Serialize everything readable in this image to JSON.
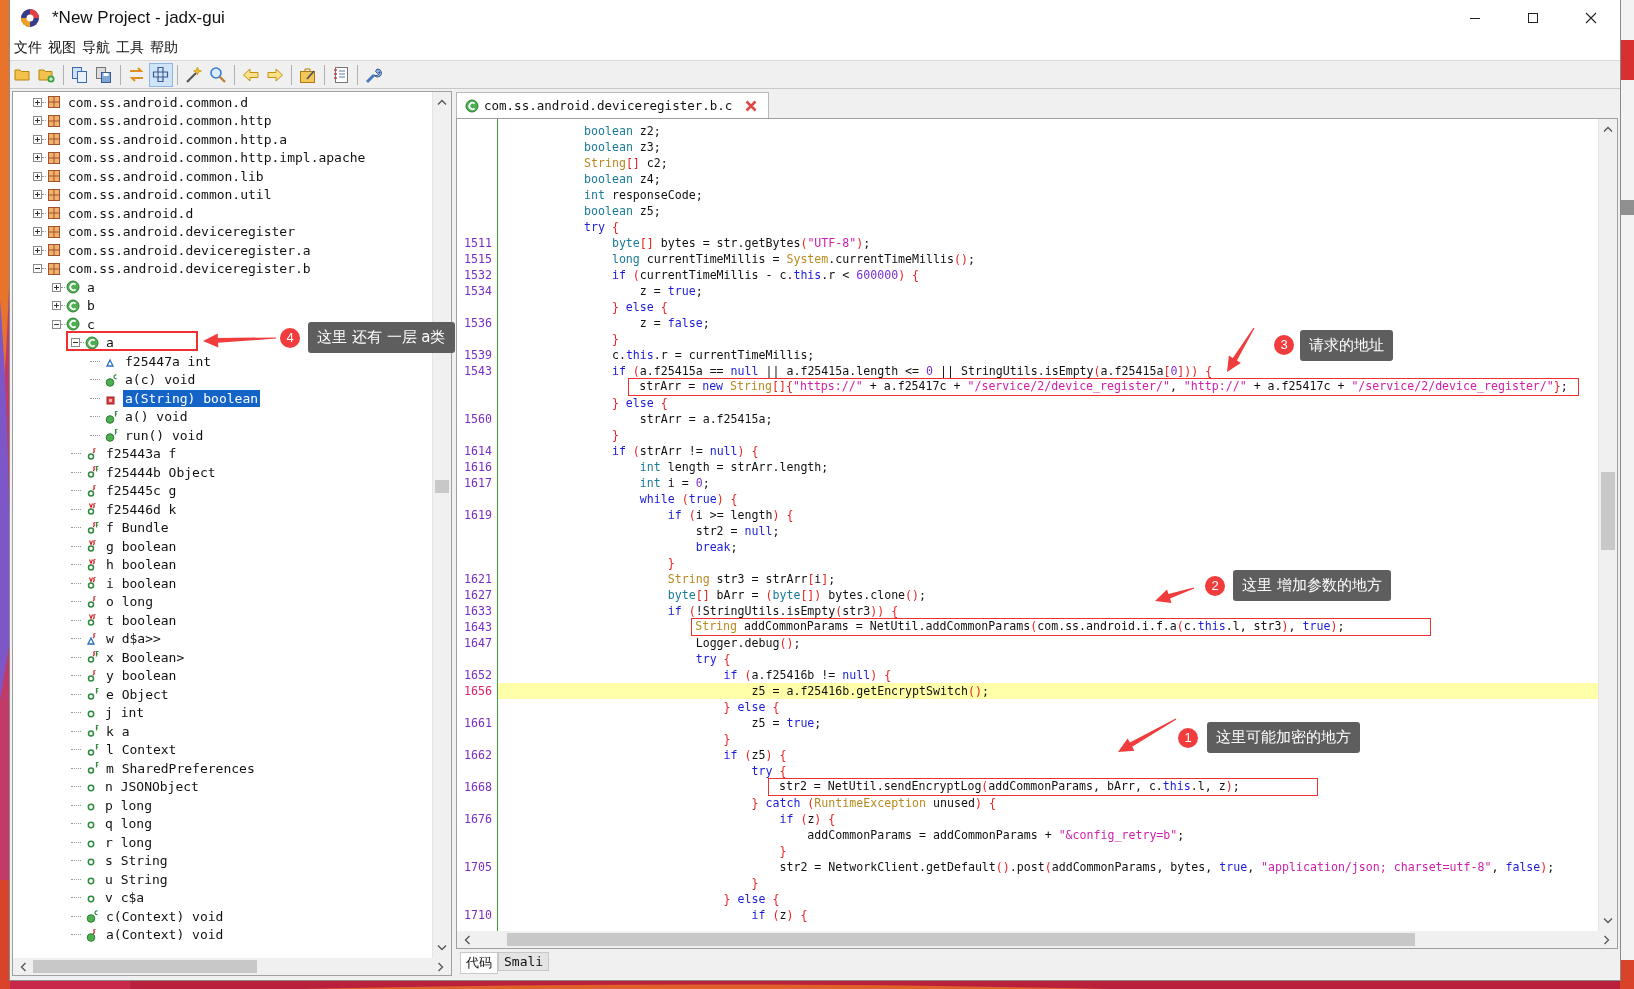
{
  "window": {
    "title": "*New Project - jadx-gui"
  },
  "menu": [
    "文件",
    "视图",
    "导航",
    "工具",
    "帮助"
  ],
  "toolbar": {
    "buttons": [
      {
        "pressed": false
      },
      {
        "pressed": false
      },
      {
        "pressed": false
      },
      {
        "pressed": false
      },
      {
        "pressed": false
      },
      {
        "pressed": true
      },
      {
        "pressed": false
      },
      {
        "pressed": false
      },
      {
        "pressed": false
      },
      {
        "pressed": false
      },
      {
        "pressed": false
      },
      {
        "pressed": false
      },
      {
        "pressed": false
      }
    ]
  },
  "tree": [
    {
      "label": "com.ss.android.common.d",
      "kind": "package",
      "expanded": false,
      "selected": false
    },
    {
      "label": "com.ss.android.common.http",
      "kind": "package",
      "expanded": false,
      "selected": false
    },
    {
      "label": "com.ss.android.common.http.a",
      "kind": "package",
      "expanded": false,
      "selected": false
    },
    {
      "label": "com.ss.android.common.http.impl.apache",
      "kind": "package",
      "expanded": false,
      "selected": false
    },
    {
      "label": "com.ss.android.common.lib",
      "kind": "package",
      "expanded": false,
      "selected": false
    },
    {
      "label": "com.ss.android.common.util",
      "kind": "package",
      "expanded": false,
      "selected": false
    },
    {
      "label": "com.ss.android.d",
      "kind": "package",
      "expanded": false,
      "selected": false
    },
    {
      "label": "com.ss.android.deviceregister",
      "kind": "package",
      "expanded": false,
      "selected": false
    },
    {
      "label": "com.ss.android.deviceregister.a",
      "kind": "package",
      "expanded": false,
      "selected": false
    },
    {
      "label": "com.ss.android.deviceregister.b",
      "kind": "package",
      "expanded": true,
      "selected": false,
      "children": [
        {
          "label": "a",
          "kind": "class",
          "expanded": false,
          "selected": false
        },
        {
          "label": "b",
          "kind": "class",
          "expanded": false,
          "selected": false
        },
        {
          "label": "c",
          "kind": "class",
          "expanded": true,
          "selected": false,
          "children": [
            {
              "label": "a",
              "kind": "class",
              "expanded": true,
              "selected": false,
              "children": [
                {
                  "label": "f25447a int",
                  "kind": "triangle",
                  "selected": false
                },
                {
                  "label": "a(c) void",
                  "kind": "method-c",
                  "selected": false
                },
                {
                  "label": "a(String) boolean",
                  "kind": "private",
                  "selected": true
                },
                {
                  "label": "a() void",
                  "kind": "method-f",
                  "selected": false
                },
                {
                  "label": "run() void",
                  "kind": "method-f",
                  "selected": false
                }
              ]
            },
            {
              "label": "f25443a f",
              "kind": "field-s",
              "selected": false
            },
            {
              "label": "f25444b Object",
              "kind": "field-sf",
              "selected": false
            },
            {
              "label": "f25445c g",
              "kind": "field-s",
              "selected": false
            },
            {
              "label": "f25446d k",
              "kind": "field-vs",
              "selected": false
            },
            {
              "label": "f Bundle",
              "kind": "field-sf",
              "selected": false
            },
            {
              "label": "g boolean",
              "kind": "field-vs",
              "selected": false
            },
            {
              "label": "h boolean",
              "kind": "field-vs",
              "selected": false
            },
            {
              "label": "i boolean",
              "kind": "field-vs",
              "selected": false
            },
            {
              "label": "o long",
              "kind": "field-s",
              "selected": false
            },
            {
              "label": "t boolean",
              "kind": "field-vs",
              "selected": false
            },
            {
              "label": "w d$a>>",
              "kind": "triangle-s",
              "selected": false
            },
            {
              "label": "x Boolean>",
              "kind": "field-sf",
              "selected": false
            },
            {
              "label": "y boolean",
              "kind": "field-s",
              "selected": false
            },
            {
              "label": "e Object",
              "kind": "field-f",
              "selected": false
            },
            {
              "label": "j int",
              "kind": "field",
              "selected": false
            },
            {
              "label": "k a",
              "kind": "field-f",
              "selected": false
            },
            {
              "label": "l Context",
              "kind": "field-f",
              "selected": false
            },
            {
              "label": "m SharedPreferences",
              "kind": "field-f",
              "selected": false
            },
            {
              "label": "n JSONObject",
              "kind": "field",
              "selected": false
            },
            {
              "label": "p long",
              "kind": "field",
              "selected": false
            },
            {
              "label": "q long",
              "kind": "field",
              "selected": false
            },
            {
              "label": "r long",
              "kind": "field",
              "selected": false
            },
            {
              "label": "s String",
              "kind": "field",
              "selected": false
            },
            {
              "label": "u String",
              "kind": "field",
              "selected": false
            },
            {
              "label": "v c$a",
              "kind": "field",
              "selected": false
            },
            {
              "label": "c(Context) void",
              "kind": "method-c",
              "selected": false
            },
            {
              "label": "a(Context) void",
              "kind": "method-s",
              "selected": false
            }
          ]
        }
      ]
    }
  ],
  "editor": {
    "tabs": [
      {
        "label": "com.ss.android.deviceregister.b.c",
        "selected": true
      }
    ],
    "lines": [
      {
        "highlighted": false,
        "tokens": [
          {
            "kind": "type",
            "text": "boolean"
          },
          {
            "kind": "plain",
            "text": " z2;"
          }
        ]
      },
      {
        "highlighted": false,
        "tokens": [
          {
            "kind": "type",
            "text": "boolean"
          },
          {
            "kind": "plain",
            "text": " z3;"
          }
        ]
      },
      {
        "highlighted": false,
        "tokens": [
          {
            "kind": "class",
            "text": "String"
          },
          {
            "kind": "bracket",
            "text": "[]"
          },
          {
            "kind": "plain",
            "text": " c2;"
          }
        ]
      },
      {
        "highlighted": false,
        "tokens": [
          {
            "kind": "type",
            "text": "boolean"
          },
          {
            "kind": "plain",
            "text": " z4;"
          }
        ]
      },
      {
        "highlighted": false,
        "tokens": [
          {
            "kind": "type",
            "text": "int"
          },
          {
            "kind": "plain",
            "text": " responseCode;"
          }
        ]
      },
      {
        "highlighted": false,
        "tokens": [
          {
            "kind": "type",
            "text": "boolean"
          },
          {
            "kind": "plain",
            "text": " z5;"
          }
        ]
      },
      {
        "highlighted": false,
        "tokens": [
          {
            "kind": "keyword",
            "text": "try"
          },
          {
            "kind": "bracket",
            "text": " {"
          }
        ]
      },
      {
        "number": "1511",
        "highlighted": false,
        "tokens": [
          {
            "kind": "type",
            "text": "    byte"
          },
          {
            "kind": "bracket",
            "text": "[]"
          },
          {
            "kind": "plain",
            "text": " bytes = str.getBytes"
          },
          {
            "kind": "bracket",
            "text": "("
          },
          {
            "kind": "string",
            "text": "\"UTF-8\""
          },
          {
            "kind": "bracket",
            "text": ")"
          },
          {
            "kind": "plain",
            "text": ";"
          }
        ]
      },
      {
        "number": "1515",
        "highlighted": false,
        "tokens": [
          {
            "kind": "type",
            "text": "    long"
          },
          {
            "kind": "plain",
            "text": " currentTimeMillis = "
          },
          {
            "kind": "class",
            "text": "System"
          },
          {
            "kind": "plain",
            "text": ".currentTimeMillis"
          },
          {
            "kind": "bracket",
            "text": "()"
          },
          {
            "kind": "plain",
            "text": ";"
          }
        ]
      },
      {
        "number": "1532",
        "highlighted": false,
        "tokens": [
          {
            "kind": "keyword",
            "text": "    if"
          },
          {
            "kind": "bracket",
            "text": " ("
          },
          {
            "kind": "plain",
            "text": "currentTimeMillis - c."
          },
          {
            "kind": "keyword",
            "text": "this"
          },
          {
            "kind": "plain",
            "text": ".r < "
          },
          {
            "kind": "number",
            "text": "600000"
          },
          {
            "kind": "bracket",
            "text": ")"
          },
          {
            "kind": "bracket",
            "text": " {"
          }
        ]
      },
      {
        "number": "1534",
        "highlighted": false,
        "tokens": [
          {
            "kind": "plain",
            "text": "        z = "
          },
          {
            "kind": "keyword",
            "text": "true"
          },
          {
            "kind": "plain",
            "text": ";"
          }
        ]
      },
      {
        "highlighted": false,
        "tokens": [
          {
            "kind": "bracket",
            "text": "    }"
          },
          {
            "kind": "keyword",
            "text": " else"
          },
          {
            "kind": "bracket",
            "text": " {"
          }
        ]
      },
      {
        "number": "1536",
        "highlighted": false,
        "tokens": [
          {
            "kind": "plain",
            "text": "        z = "
          },
          {
            "kind": "keyword",
            "text": "false"
          },
          {
            "kind": "plain",
            "text": ";"
          }
        ]
      },
      {
        "highlighted": false,
        "tokens": [
          {
            "kind": "bracket",
            "text": "    }"
          }
        ]
      },
      {
        "number": "1539",
        "highlighted": false,
        "tokens": [
          {
            "kind": "plain",
            "text": "    c."
          },
          {
            "kind": "keyword",
            "text": "this"
          },
          {
            "kind": "plain",
            "text": ".r = currentTimeMillis;"
          }
        ]
      },
      {
        "number": "1543",
        "highlighted": false,
        "tokens": [
          {
            "kind": "keyword",
            "text": "    if"
          },
          {
            "kind": "bracket",
            "text": " ("
          },
          {
            "kind": "plain",
            "text": "a.f25415a == "
          },
          {
            "kind": "keyword",
            "text": "null"
          },
          {
            "kind": "plain",
            "text": " || a.f25415a.length <= "
          },
          {
            "kind": "number",
            "text": "0"
          },
          {
            "kind": "plain",
            "text": " || StringUtils.isEmpty"
          },
          {
            "kind": "bracket",
            "text": "("
          },
          {
            "kind": "plain",
            "text": "a.f25415a"
          },
          {
            "kind": "bracket",
            "text": "["
          },
          {
            "kind": "number",
            "text": "0"
          },
          {
            "kind": "bracket",
            "text": "]))"
          },
          {
            "kind": "bracket",
            "text": " {"
          }
        ]
      },
      {
        "highlighted": false,
        "tokens": [
          {
            "kind": "plain",
            "text": "        strArr = "
          },
          {
            "kind": "keyword",
            "text": "new"
          },
          {
            "kind": "class",
            "text": " String"
          },
          {
            "kind": "bracket",
            "text": "[]{"
          },
          {
            "kind": "string",
            "text": "\"https://\""
          },
          {
            "kind": "plain",
            "text": " + a.f25417c + "
          },
          {
            "kind": "string",
            "text": "\"/service/2/device_register/\""
          },
          {
            "kind": "plain",
            "text": ", "
          },
          {
            "kind": "string",
            "text": "\"http://\""
          },
          {
            "kind": "plain",
            "text": " + a.f25417c + "
          },
          {
            "kind": "string",
            "text": "\"/service/2/device_register/\""
          },
          {
            "kind": "bracket",
            "text": "}"
          },
          {
            "kind": "plain",
            "text": ";"
          }
        ]
      },
      {
        "highlighted": false,
        "tokens": [
          {
            "kind": "bracket",
            "text": "    }"
          },
          {
            "kind": "keyword",
            "text": " else"
          },
          {
            "kind": "bracket",
            "text": " {"
          }
        ]
      },
      {
        "number": "1560",
        "highlighted": false,
        "tokens": [
          {
            "kind": "plain",
            "text": "        strArr = a.f25415a;"
          }
        ]
      },
      {
        "highlighted": false,
        "tokens": [
          {
            "kind": "bracket",
            "text": "    }"
          }
        ]
      },
      {
        "number": "1614",
        "highlighted": false,
        "tokens": [
          {
            "kind": "keyword",
            "text": "    if"
          },
          {
            "kind": "bracket",
            "text": " ("
          },
          {
            "kind": "plain",
            "text": "strArr != "
          },
          {
            "kind": "keyword",
            "text": "null"
          },
          {
            "kind": "bracket",
            "text": ")"
          },
          {
            "kind": "bracket",
            "text": " {"
          }
        ]
      },
      {
        "number": "1616",
        "highlighted": false,
        "tokens": [
          {
            "kind": "type",
            "text": "        int"
          },
          {
            "kind": "plain",
            "text": " length = strArr.length;"
          }
        ]
      },
      {
        "number": "1617",
        "highlighted": false,
        "tokens": [
          {
            "kind": "type",
            "text": "        int"
          },
          {
            "kind": "plain",
            "text": " i = "
          },
          {
            "kind": "number",
            "text": "0"
          },
          {
            "kind": "plain",
            "text": ";"
          }
        ]
      },
      {
        "highlighted": false,
        "tokens": [
          {
            "kind": "keyword",
            "text": "        while"
          },
          {
            "kind": "bracket",
            "text": " ("
          },
          {
            "kind": "keyword",
            "text": "true"
          },
          {
            "kind": "bracket",
            "text": ")"
          },
          {
            "kind": "bracket",
            "text": " {"
          }
        ]
      },
      {
        "number": "1619",
        "highlighted": false,
        "tokens": [
          {
            "kind": "keyword",
            "text": "            if"
          },
          {
            "kind": "bracket",
            "text": " ("
          },
          {
            "kind": "plain",
            "text": "i >= length"
          },
          {
            "kind": "bracket",
            "text": ")"
          },
          {
            "kind": "bracket",
            "text": " {"
          }
        ]
      },
      {
        "highlighted": false,
        "tokens": [
          {
            "kind": "plain",
            "text": "                str2 = "
          },
          {
            "kind": "keyword",
            "text": "null"
          },
          {
            "kind": "plain",
            "text": ";"
          }
        ]
      },
      {
        "highlighted": false,
        "tokens": [
          {
            "kind": "keyword",
            "text": "                break"
          },
          {
            "kind": "plain",
            "text": ";"
          }
        ]
      },
      {
        "highlighted": false,
        "tokens": [
          {
            "kind": "bracket",
            "text": "            }"
          }
        ]
      },
      {
        "number": "1621",
        "highlighted": false,
        "tokens": [
          {
            "kind": "class",
            "text": "            String"
          },
          {
            "kind": "plain",
            "text": " str3 = strArr"
          },
          {
            "kind": "bracket",
            "text": "["
          },
          {
            "kind": "plain",
            "text": "i"
          },
          {
            "kind": "bracket",
            "text": "]"
          },
          {
            "kind": "plain",
            "text": ";"
          }
        ]
      },
      {
        "number": "1627",
        "highlighted": false,
        "tokens": [
          {
            "kind": "type",
            "text": "            byte"
          },
          {
            "kind": "bracket",
            "text": "[]"
          },
          {
            "kind": "plain",
            "text": " bArr = "
          },
          {
            "kind": "bracket",
            "text": "("
          },
          {
            "kind": "type",
            "text": "byte"
          },
          {
            "kind": "bracket",
            "text": "[])"
          },
          {
            "kind": "plain",
            "text": " bytes.clone"
          },
          {
            "kind": "bracket",
            "text": "()"
          },
          {
            "kind": "plain",
            "text": ";"
          }
        ]
      },
      {
        "number": "1633",
        "highlighted": false,
        "tokens": [
          {
            "kind": "keyword",
            "text": "            if"
          },
          {
            "kind": "bracket",
            "text": " ("
          },
          {
            "kind": "plain",
            "text": "!StringUtils.isEmpty"
          },
          {
            "kind": "bracket",
            "text": "("
          },
          {
            "kind": "plain",
            "text": "str3"
          },
          {
            "kind": "bracket",
            "text": "))"
          },
          {
            "kind": "bracket",
            "text": " {"
          }
        ]
      },
      {
        "number": "1643",
        "highlighted": false,
        "tokens": [
          {
            "kind": "class",
            "text": "                String"
          },
          {
            "kind": "plain",
            "text": " addCommonParams = NetUtil.addCommonParams"
          },
          {
            "kind": "bracket",
            "text": "("
          },
          {
            "kind": "plain",
            "text": "com.ss.android.i.f.a"
          },
          {
            "kind": "bracket",
            "text": "("
          },
          {
            "kind": "plain",
            "text": "c."
          },
          {
            "kind": "keyword",
            "text": "this"
          },
          {
            "kind": "plain",
            "text": ".l, str3"
          },
          {
            "kind": "bracket",
            "text": ")"
          },
          {
            "kind": "plain",
            "text": ", "
          },
          {
            "kind": "keyword",
            "text": "true"
          },
          {
            "kind": "bracket",
            "text": ")"
          },
          {
            "kind": "plain",
            "text": ";"
          }
        ]
      },
      {
        "number": "1647",
        "highlighted": false,
        "tokens": [
          {
            "kind": "plain",
            "text": "                Logger.debug"
          },
          {
            "kind": "bracket",
            "text": "()"
          },
          {
            "kind": "plain",
            "text": ";"
          }
        ]
      },
      {
        "highlighted": false,
        "tokens": [
          {
            "kind": "keyword",
            "text": "                try"
          },
          {
            "kind": "bracket",
            "text": " {"
          }
        ]
      },
      {
        "number": "1652",
        "highlighted": false,
        "tokens": [
          {
            "kind": "keyword",
            "text": "                    if"
          },
          {
            "kind": "bracket",
            "text": " ("
          },
          {
            "kind": "plain",
            "text": "a.f25416b != "
          },
          {
            "kind": "keyword",
            "text": "null"
          },
          {
            "kind": "bracket",
            "text": ")"
          },
          {
            "kind": "bracket",
            "text": " {"
          }
        ]
      },
      {
        "number": "1656",
        "highlighted": true,
        "tokens": [
          {
            "kind": "plain",
            "text": "                        z5 = a.f25416b.getEncryptSwitch"
          },
          {
            "kind": "bracket",
            "text": "()"
          },
          {
            "kind": "plain",
            "text": ";"
          }
        ]
      },
      {
        "highlighted": false,
        "tokens": [
          {
            "kind": "bracket",
            "text": "                    }"
          },
          {
            "kind": "keyword",
            "text": " else"
          },
          {
            "kind": "bracket",
            "text": " {"
          }
        ]
      },
      {
        "number": "1661",
        "highlighted": false,
        "tokens": [
          {
            "kind": "plain",
            "text": "                        z5 = "
          },
          {
            "kind": "keyword",
            "text": "true"
          },
          {
            "kind": "plain",
            "text": ";"
          }
        ]
      },
      {
        "highlighted": false,
        "tokens": [
          {
            "kind": "bracket",
            "text": "                    }"
          }
        ]
      },
      {
        "number": "1662",
        "highlighted": false,
        "tokens": [
          {
            "kind": "keyword",
            "text": "                    if"
          },
          {
            "kind": "bracket",
            "text": " ("
          },
          {
            "kind": "plain",
            "text": "z5"
          },
          {
            "kind": "bracket",
            "text": ")"
          },
          {
            "kind": "bracket",
            "text": " {"
          }
        ]
      },
      {
        "highlighted": false,
        "tokens": [
          {
            "kind": "keyword",
            "text": "                        try"
          },
          {
            "kind": "bracket",
            "text": " {"
          }
        ]
      },
      {
        "number": "1668",
        "highlighted": false,
        "tokens": [
          {
            "kind": "plain",
            "text": "                            str2 = NetUtil.sendEncryptLog"
          },
          {
            "kind": "bracket",
            "text": "("
          },
          {
            "kind": "plain",
            "text": "addCommonParams, bArr, c."
          },
          {
            "kind": "keyword",
            "text": "this"
          },
          {
            "kind": "plain",
            "text": ".l, z"
          },
          {
            "kind": "bracket",
            "text": ")"
          },
          {
            "kind": "plain",
            "text": ";"
          }
        ]
      },
      {
        "highlighted": false,
        "tokens": [
          {
            "kind": "bracket",
            "text": "                        }"
          },
          {
            "kind": "keyword",
            "text": " catch"
          },
          {
            "kind": "bracket",
            "text": " ("
          },
          {
            "kind": "class",
            "text": "RuntimeException"
          },
          {
            "kind": "plain",
            "text": " unused"
          },
          {
            "kind": "bracket",
            "text": ")"
          },
          {
            "kind": "bracket",
            "text": " {"
          }
        ]
      },
      {
        "number": "1676",
        "highlighted": false,
        "tokens": [
          {
            "kind": "keyword",
            "text": "                            if"
          },
          {
            "kind": "bracket",
            "text": " ("
          },
          {
            "kind": "plain",
            "text": "z"
          },
          {
            "kind": "bracket",
            "text": ")"
          },
          {
            "kind": "bracket",
            "text": " {"
          }
        ]
      },
      {
        "highlighted": false,
        "tokens": [
          {
            "kind": "plain",
            "text": "                                addCommonParams = addCommonParams + "
          },
          {
            "kind": "string",
            "text": "\"&config_retry=b\""
          },
          {
            "kind": "plain",
            "text": ";"
          }
        ]
      },
      {
        "highlighted": false,
        "tokens": [
          {
            "kind": "bracket",
            "text": "                            }"
          }
        ]
      },
      {
        "number": "1705",
        "highlighted": false,
        "tokens": [
          {
            "kind": "plain",
            "text": "                            str2 = NetworkClient.getDefault"
          },
          {
            "kind": "bracket",
            "text": "()"
          },
          {
            "kind": "plain",
            "text": ".post"
          },
          {
            "kind": "bracket",
            "text": "("
          },
          {
            "kind": "plain",
            "text": "addCommonParams, bytes, "
          },
          {
            "kind": "keyword",
            "text": "true"
          },
          {
            "kind": "plain",
            "text": ", "
          },
          {
            "kind": "string",
            "text": "\"application/json; charset=utf-8\""
          },
          {
            "kind": "plain",
            "text": ", "
          },
          {
            "kind": "keyword",
            "text": "false"
          },
          {
            "kind": "bracket",
            "text": ")"
          },
          {
            "kind": "plain",
            "text": ";"
          }
        ]
      },
      {
        "highlighted": false,
        "tokens": [
          {
            "kind": "bracket",
            "text": "                        }"
          }
        ]
      },
      {
        "highlighted": false,
        "tokens": [
          {
            "kind": "bracket",
            "text": "                    }"
          },
          {
            "kind": "keyword",
            "text": " else"
          },
          {
            "kind": "bracket",
            "text": " {"
          }
        ]
      },
      {
        "number": "1710",
        "highlighted": false,
        "tokens": [
          {
            "kind": "keyword",
            "text": "                        if"
          },
          {
            "kind": "bracket",
            "text": " ("
          },
          {
            "kind": "plain",
            "text": "z"
          },
          {
            "kind": "bracket",
            "text": ")"
          },
          {
            "kind": "bracket",
            "text": " {"
          }
        ]
      }
    ],
    "bottom_tabs": [
      {
        "label": "代码",
        "selected": true
      },
      {
        "label": "Smali",
        "selected": false
      }
    ]
  },
  "annotations": [
    {
      "number": "4",
      "text": "这里 还有 一层 a类"
    },
    {
      "number": "3",
      "text": "请求的地址"
    },
    {
      "number": "2",
      "text": "这里 增加参数的地方"
    },
    {
      "number": "1",
      "text": "这里可能加密的地方"
    }
  ]
}
